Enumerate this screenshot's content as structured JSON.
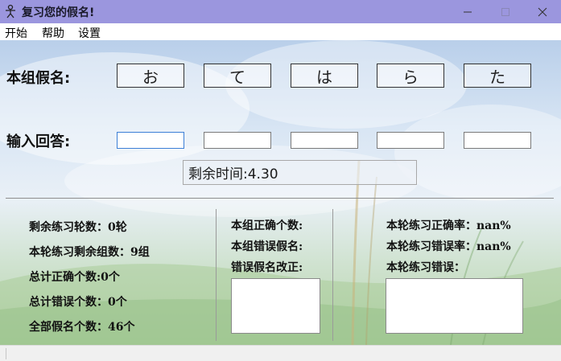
{
  "window": {
    "title": "复习您的假名!",
    "icon": "app-person-icon",
    "controls": [
      "minimize-icon",
      "maximize-icon",
      "close-icon"
    ]
  },
  "menu": {
    "items": [
      "开始",
      "帮助",
      "设置"
    ]
  },
  "main": {
    "group_label": "本组假名:",
    "kana": [
      "お",
      "て",
      "は",
      "ら",
      "た"
    ],
    "answer_label": "输入回答:",
    "answers": [
      "",
      "",
      "",
      "",
      ""
    ],
    "timer": "剩余时间:4.30"
  },
  "stats": {
    "left": {
      "rounds_left": "剩余练习轮数：0轮",
      "groups_left": "本轮练习剩余组数：9组",
      "total_correct": "总计正确个数:0个",
      "total_wrong": "总计错误个数：0个",
      "total_kana": "全部假名个数：46个"
    },
    "middle": {
      "group_correct": "本组正确个数:",
      "group_wrong": "本组错误假名:",
      "correction": "错误假名改正:",
      "correction_text": ""
    },
    "right": {
      "accuracy": "本轮练习正确率：nan%",
      "error_rate": "本轮练习错误率：nan%",
      "errors": "本轮练习错误：",
      "errors_text": ""
    }
  },
  "colors": {
    "titlebar": "#9b96de",
    "sky": "#c8dcf0",
    "grass": "#b5d3a9",
    "focus": "#3c7fd6"
  }
}
